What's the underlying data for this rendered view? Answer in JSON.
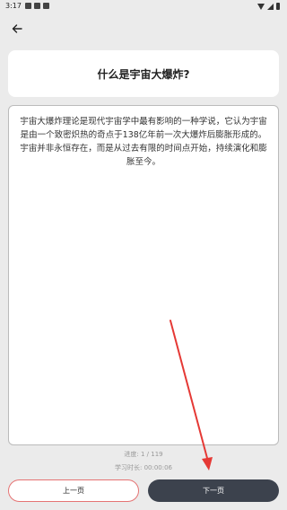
{
  "status_bar": {
    "time": "3:17"
  },
  "page": {
    "title": "什么是宇宙大爆炸?",
    "content": "宇宙大爆炸理论是现代宇宙学中最有影响的一种学说，它认为宇宙是由一个致密炽热的奇点于138亿年前一次大爆炸后膨胀形成的。宇宙并非永恒存在，而是从过去有限的时间点开始，持续演化和膨胀至今。"
  },
  "footer": {
    "progress_label": "进度: 1 / 119",
    "study_time_label": "学习时长: 00:00:06"
  },
  "buttons": {
    "prev_label": "上一页",
    "next_label": "下一页"
  },
  "colors": {
    "arrow": "#e53935",
    "next_button_bg": "#3c424d",
    "prev_button_border": "#e57373"
  }
}
